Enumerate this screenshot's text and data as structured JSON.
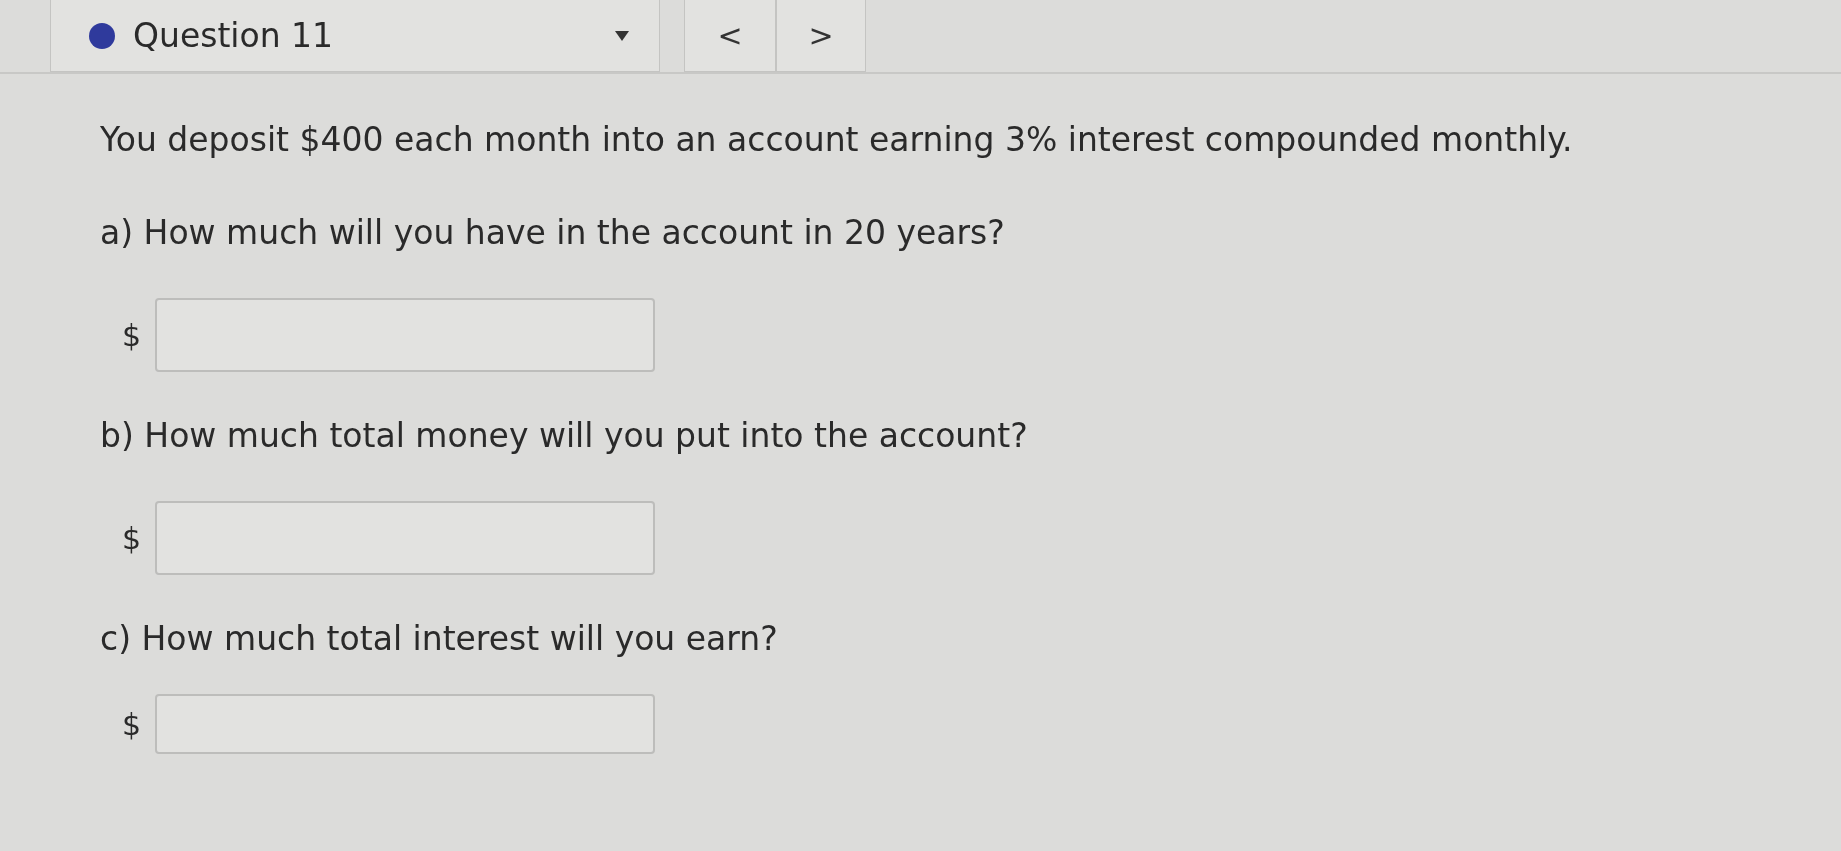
{
  "header": {
    "title": "Question 11",
    "prev": "<",
    "next": ">"
  },
  "question": "You deposit $400 each month into an account earning 3% interest compounded monthly.",
  "parts": [
    {
      "prompt": "a) How much will you have in the account in 20 years?",
      "currency": "$"
    },
    {
      "prompt": "b) How much total money will you put into the account?",
      "currency": "$"
    },
    {
      "prompt": "c) How much total interest will you earn?",
      "currency": "$"
    }
  ]
}
